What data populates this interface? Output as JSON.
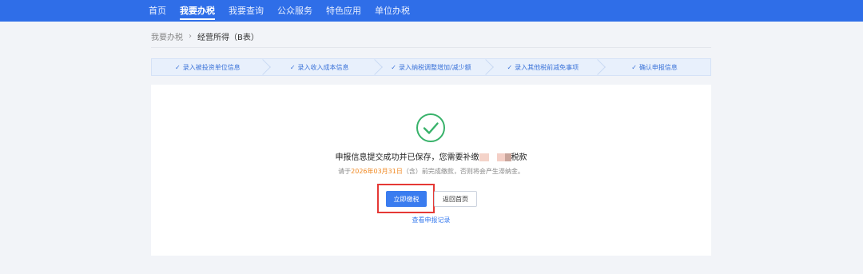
{
  "nav": {
    "items": [
      "首页",
      "我要办税",
      "我要查询",
      "公众服务",
      "特色应用",
      "单位办税"
    ],
    "active_index": 1
  },
  "breadcrumb": {
    "parent": "我要办税",
    "separator": "›",
    "current": "经营所得（B表）"
  },
  "steps": [
    {
      "label": "录入被投资单位信息",
      "status": "done"
    },
    {
      "label": "录入收入成本信息",
      "status": "done"
    },
    {
      "label": "录入纳税调整增加/减少额",
      "status": "done"
    },
    {
      "label": "录入其他税前减免事项",
      "status": "done"
    },
    {
      "label": "确认申报信息",
      "status": "done"
    }
  ],
  "result": {
    "icon": "success-check-icon",
    "message_prefix": "申报信息提交成功并已保存，您需要补缴",
    "message_suffix": "税款",
    "notice_prefix": "请于",
    "deadline": "2026年03月31日",
    "notice_suffix": "（含）前完成缴款，否则将会产生滞纳金。",
    "pay_button": "立即缴税",
    "home_button": "返回首页",
    "records_link": "查看申报记录"
  },
  "colors": {
    "primary": "#2f6ee8",
    "success": "#38b26a",
    "warning": "#f08a24",
    "highlight": "#e53935"
  }
}
